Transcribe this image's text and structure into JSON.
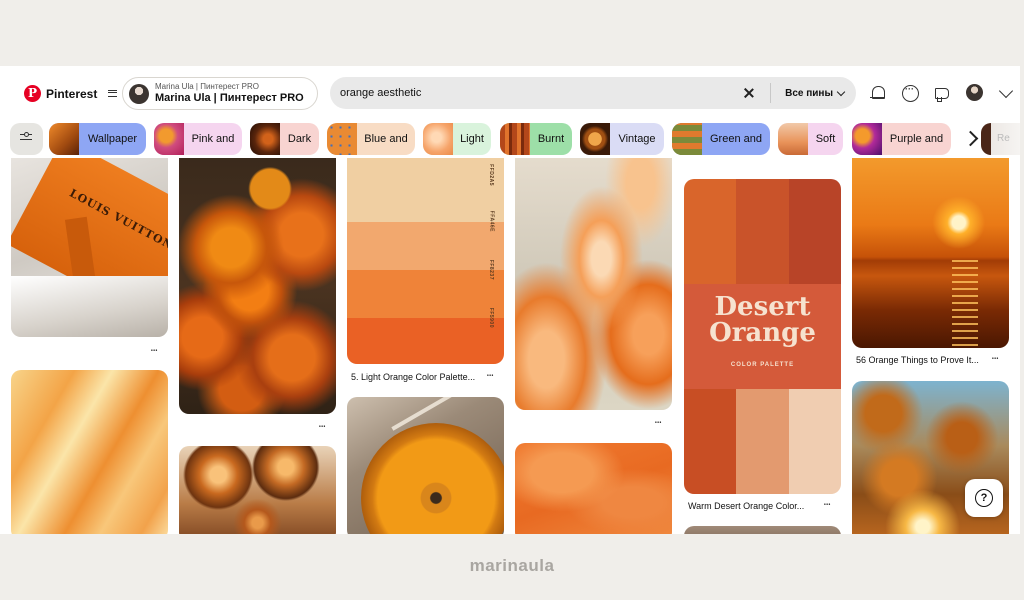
{
  "header": {
    "logo_text": "Pinterest",
    "account": {
      "subtitle": "Marina Ula | Пинтерест PRO",
      "name": "Marina Ula | Пинтерест PRO"
    },
    "search": {
      "query": "orange aesthetic",
      "scope": "Все пины"
    }
  },
  "chips": [
    {
      "label": "Wallpaper",
      "bg": "#8ea6f4"
    },
    {
      "label": "Pink and",
      "bg": "#f5d5ef"
    },
    {
      "label": "Dark",
      "bg": "#f8d4d1"
    },
    {
      "label": "Blue and",
      "bg": "#f8dcc4"
    },
    {
      "label": "Light",
      "bg": "#d9f3dc"
    },
    {
      "label": "Burnt",
      "bg": "#9ddfa8"
    },
    {
      "label": "Vintage",
      "bg": "#dadcf5"
    },
    {
      "label": "Green and",
      "bg": "#8ea6f4"
    },
    {
      "label": "Soft",
      "bg": "#f5d5ef"
    },
    {
      "label": "Purple and",
      "bg": "#f8d4d1"
    }
  ],
  "chip_partial": "Re",
  "pins": {
    "louis_vuitton": {
      "brand_text": "LOUIS VUITTON"
    },
    "palette": {
      "codes": [
        "FFD2A5",
        "FFA46E",
        "FF8237",
        "FF5900"
      ],
      "caption": "5. Light Orange Color Palette..."
    },
    "desert": {
      "title_line1": "Desert",
      "title_line2": "Orange",
      "subtitle": "COLOR PALETTE",
      "caption": "Warm Desert Orange Color..."
    },
    "sunset": {
      "caption": "56 Orange Things to Prove It..."
    }
  },
  "watermark": "marinaula",
  "colors": {
    "brand_red": "#e60023",
    "search_bg": "#e9e9e9",
    "page_bg": "#f0eeea"
  }
}
